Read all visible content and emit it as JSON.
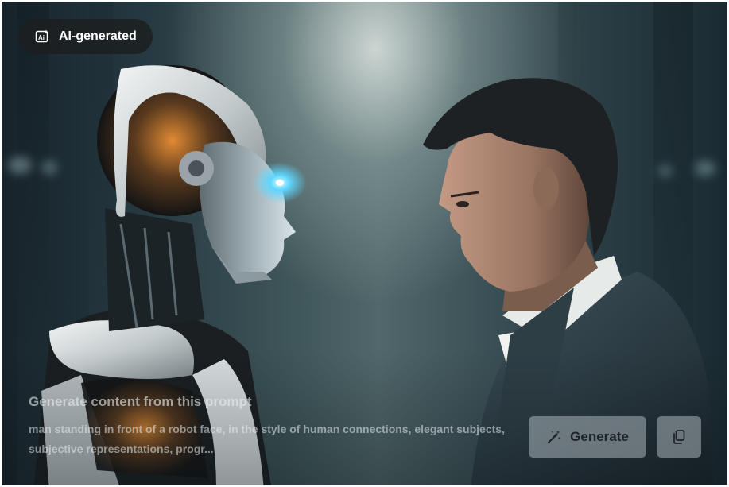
{
  "badge": {
    "icon": "ai-sparkle-icon",
    "label": "AI-generated"
  },
  "prompt": {
    "title": "Generate content from this prompt",
    "text": "man standing in front of a robot face, in the style of human connections, elegant subjects, subjective representations, progr..."
  },
  "actions": {
    "generate_label": "Generate",
    "generate_icon": "magic-wand-icon",
    "copy_icon": "copy-icon"
  },
  "image": {
    "subject": "photo",
    "accent_color": "#5fd6ff"
  }
}
